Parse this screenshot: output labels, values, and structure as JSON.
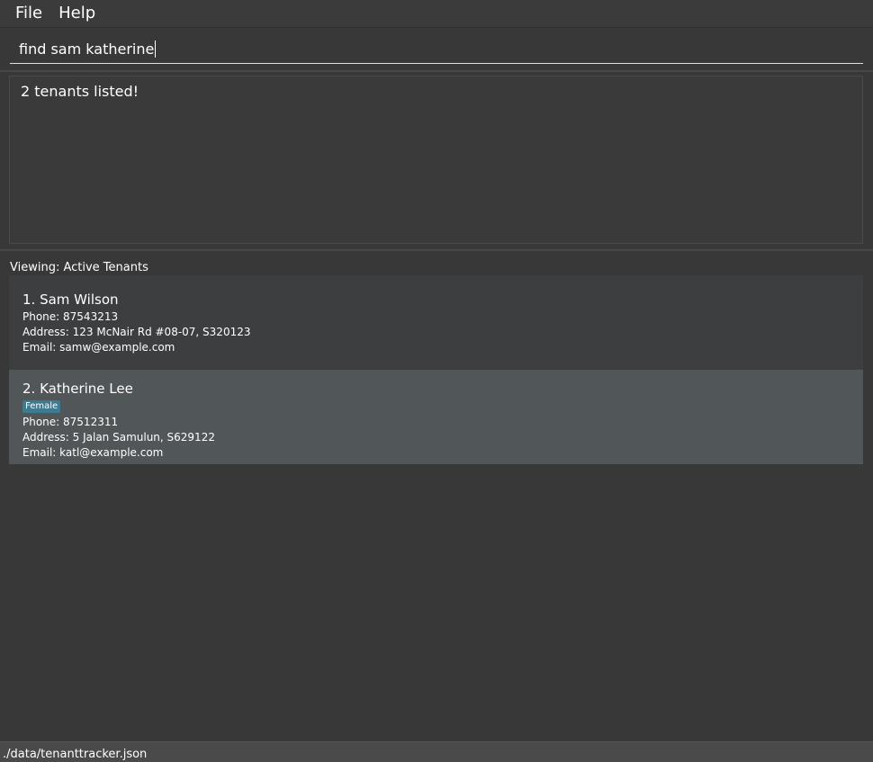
{
  "menubar": {
    "file_label": "File",
    "help_label": "Help"
  },
  "command": {
    "value": "find sam katherine"
  },
  "result": {
    "message": "2 tenants listed!"
  },
  "list": {
    "title": "Viewing: Active Tenants",
    "tenants": [
      {
        "name": "1. Sam Wilson",
        "tags": [],
        "phone": "Phone: 87543213",
        "address": "Address: 123 McNair Rd #08-07, S320123",
        "email": "Email: samw@example.com"
      },
      {
        "name": "2. Katherine Lee",
        "tags": [
          "Female"
        ],
        "phone": "Phone: 87512311",
        "address": "Address: 5 Jalan Samulun, S629122",
        "email": "Email: katl@example.com"
      }
    ]
  },
  "statusbar": {
    "path": "./data/tenanttracker.json"
  },
  "colors": {
    "background": "#383838",
    "card_odd": "#3d3e40",
    "card_selected": "#515658",
    "tag": "#3e7b91"
  }
}
